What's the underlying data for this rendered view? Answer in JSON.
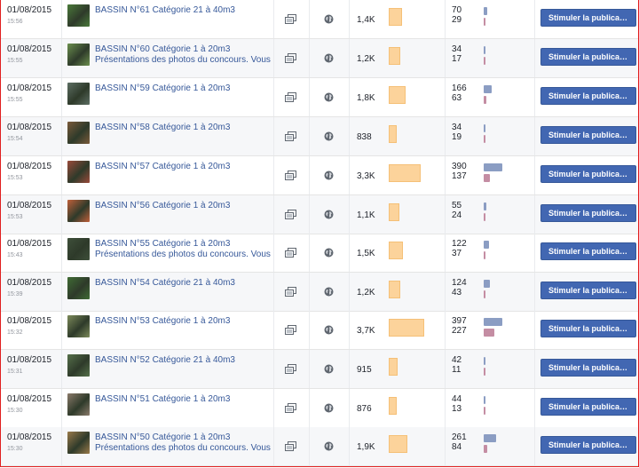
{
  "boost_label": "Stimuler la publica…",
  "colors": {
    "link": "#365899",
    "reach_bar": "#fcd39b",
    "engagement_bar_1": "#8b9dc3",
    "engagement_bar_2": "#c48da3",
    "boost_button": "#4267b2"
  },
  "icons": {
    "post_type": "shared-post-icon",
    "audience": "globe-icon"
  },
  "posts": [
    {
      "date": "01/08/2015",
      "time": "15:56",
      "title": "BASSIN N°61 Catégorie 21 à 40m3",
      "desc": "",
      "reach": "1,4K",
      "reach_value": 1400,
      "eng1": "70",
      "eng2": "29",
      "thumb": "#4a7a3a"
    },
    {
      "date": "01/08/2015",
      "time": "15:55",
      "title": "BASSIN N°60 Catégorie 1 à 20m3",
      "desc": "Présentations des photos du concours. Vous",
      "reach": "1,2K",
      "reach_value": 1200,
      "eng1": "34",
      "eng2": "17",
      "thumb": "#6b8f4e"
    },
    {
      "date": "01/08/2015",
      "time": "15:55",
      "title": "BASSIN N°59 Catégorie 1 à 20m3",
      "desc": "",
      "reach": "1,8K",
      "reach_value": 1800,
      "eng1": "166",
      "eng2": "63",
      "thumb": "#5d6e63"
    },
    {
      "date": "01/08/2015",
      "time": "15:54",
      "title": "BASSIN N°58 Catégorie 1 à 20m3",
      "desc": "",
      "reach": "838",
      "reach_value": 838,
      "eng1": "34",
      "eng2": "19",
      "thumb": "#7a5a3a"
    },
    {
      "date": "01/08/2015",
      "time": "15:53",
      "title": "BASSIN N°57 Catégorie 1 à 20m3",
      "desc": "",
      "reach": "3,3K",
      "reach_value": 3300,
      "eng1": "390",
      "eng2": "137",
      "thumb": "#9a4a3a"
    },
    {
      "date": "01/08/2015",
      "time": "15:53",
      "title": "BASSIN N°56 Catégorie 1 à 20m3",
      "desc": "",
      "reach": "1,1K",
      "reach_value": 1100,
      "eng1": "55",
      "eng2": "24",
      "thumb": "#c0603a"
    },
    {
      "date": "01/08/2015",
      "time": "15:43",
      "title": "BASSIN N°55 Catégorie 1 à 20m3",
      "desc": "Présentations des photos du concours. Vous",
      "reach": "1,5K",
      "reach_value": 1500,
      "eng1": "122",
      "eng2": "37",
      "thumb": "#3e4f3a"
    },
    {
      "date": "01/08/2015",
      "time": "15:39",
      "title": "BASSIN N°54 Catégorie 21 à 40m3",
      "desc": "",
      "reach": "1,2K",
      "reach_value": 1200,
      "eng1": "124",
      "eng2": "43",
      "thumb": "#3f6b34"
    },
    {
      "date": "01/08/2015",
      "time": "15:32",
      "title": "BASSIN N°53 Catégorie 1 à 20m3",
      "desc": "",
      "reach": "3,7K",
      "reach_value": 3700,
      "eng1": "397",
      "eng2": "227",
      "thumb": "#7c8a5a"
    },
    {
      "date": "01/08/2015",
      "time": "15:31",
      "title": "BASSIN N°52 Catégorie 21 à 40m3",
      "desc": "",
      "reach": "915",
      "reach_value": 915,
      "eng1": "42",
      "eng2": "11",
      "thumb": "#55704a"
    },
    {
      "date": "01/08/2015",
      "time": "15:30",
      "title": "BASSIN N°51 Catégorie 1 à 20m3",
      "desc": "",
      "reach": "876",
      "reach_value": 876,
      "eng1": "44",
      "eng2": "13",
      "thumb": "#8a7a6a"
    },
    {
      "date": "01/08/2015",
      "time": "15:30",
      "title": "BASSIN N°50 Catégorie 1 à 20m3",
      "desc": "Présentations des photos du concours. Vous",
      "reach": "1,9K",
      "reach_value": 1900,
      "eng1": "261",
      "eng2": "84",
      "thumb": "#9a7a4a"
    }
  ]
}
